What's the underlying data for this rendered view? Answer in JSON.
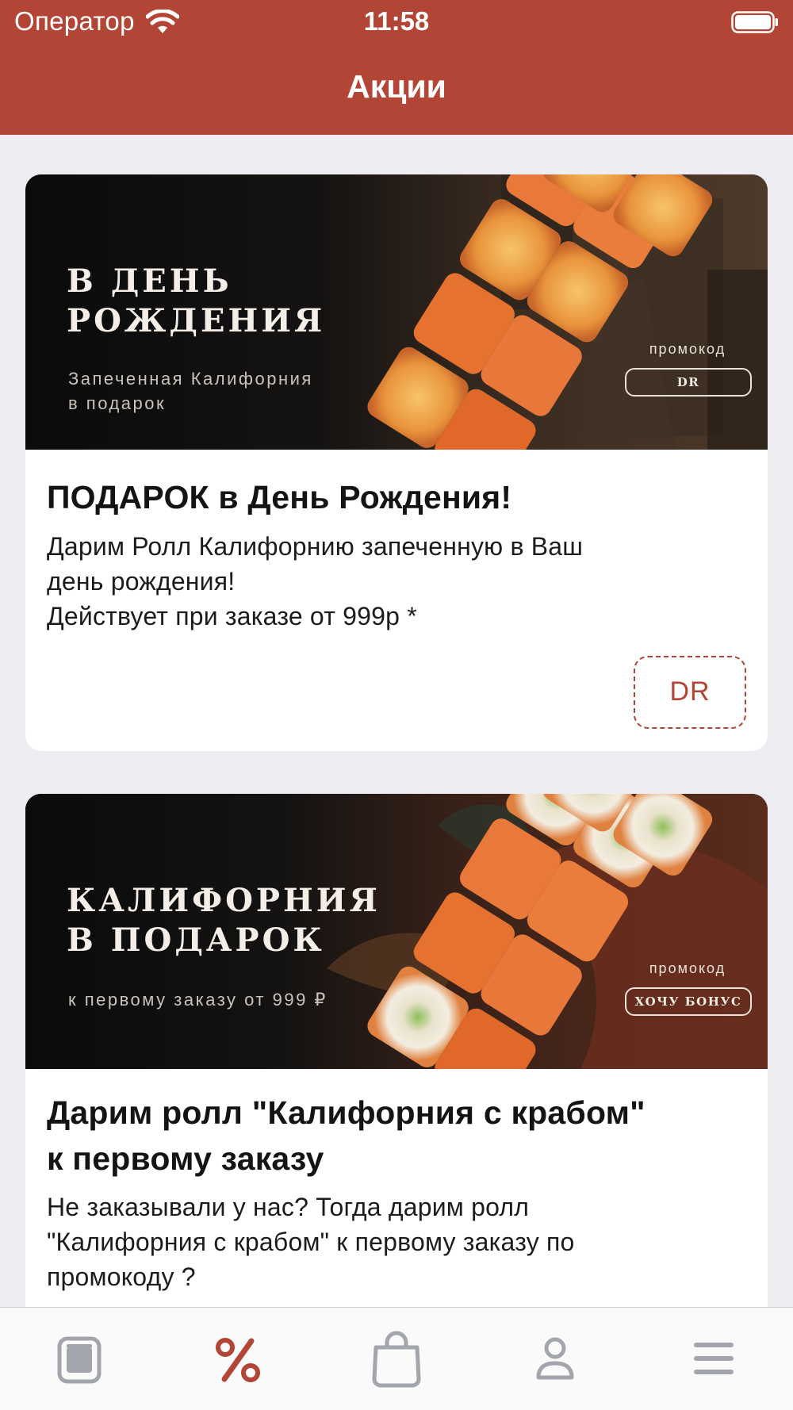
{
  "status_bar": {
    "carrier": "Оператор",
    "time": "11:58"
  },
  "header": {
    "title": "Акции"
  },
  "promos": [
    {
      "banner_headline_1": "В ДЕНЬ",
      "banner_headline_2": "РОЖДЕНИЯ",
      "banner_sub_1": "Запеченная Калифорния",
      "banner_sub_2": "в подарок",
      "banner_promo_caption": "промокод",
      "banner_promo_code": "DR",
      "title": "ПОДАРОК в День Рождения!",
      "text_1": "Дарим Ролл Калифорнию запеченную в Ваш",
      "text_2": "день рождения!",
      "text_3": "Действует при заказе от 999р *",
      "code": "DR"
    },
    {
      "banner_headline_1": "КАЛИФОРНИЯ",
      "banner_headline_2": "В ПОДАРОК",
      "banner_sub_1": "к первому заказу от 999 ₽",
      "banner_promo_caption": "промокод",
      "banner_promo_code": "ХОЧУ БОНУС",
      "title_1": "Дарим ролл \"Калифорния с крабом\"",
      "title_2": "к первому заказу",
      "text_1": "Не заказывали у нас? Тогда дарим ролл",
      "text_2": "\"Калифорния с крабом\" к первому заказу по",
      "text_3": "промокоду ?"
    }
  ],
  "tabbar": {
    "active_tab": "promotions",
    "tabs": [
      {
        "id": "menu",
        "icon": "menu-book-icon"
      },
      {
        "id": "promotions",
        "icon": "percent-icon"
      },
      {
        "id": "cart",
        "icon": "shopping-bag-icon"
      },
      {
        "id": "profile",
        "icon": "profile-icon"
      },
      {
        "id": "more",
        "icon": "hamburger-icon"
      }
    ]
  },
  "colors": {
    "brand": "#b24535",
    "inactive_icon": "#a3a5ad",
    "background": "#eeeef2"
  }
}
